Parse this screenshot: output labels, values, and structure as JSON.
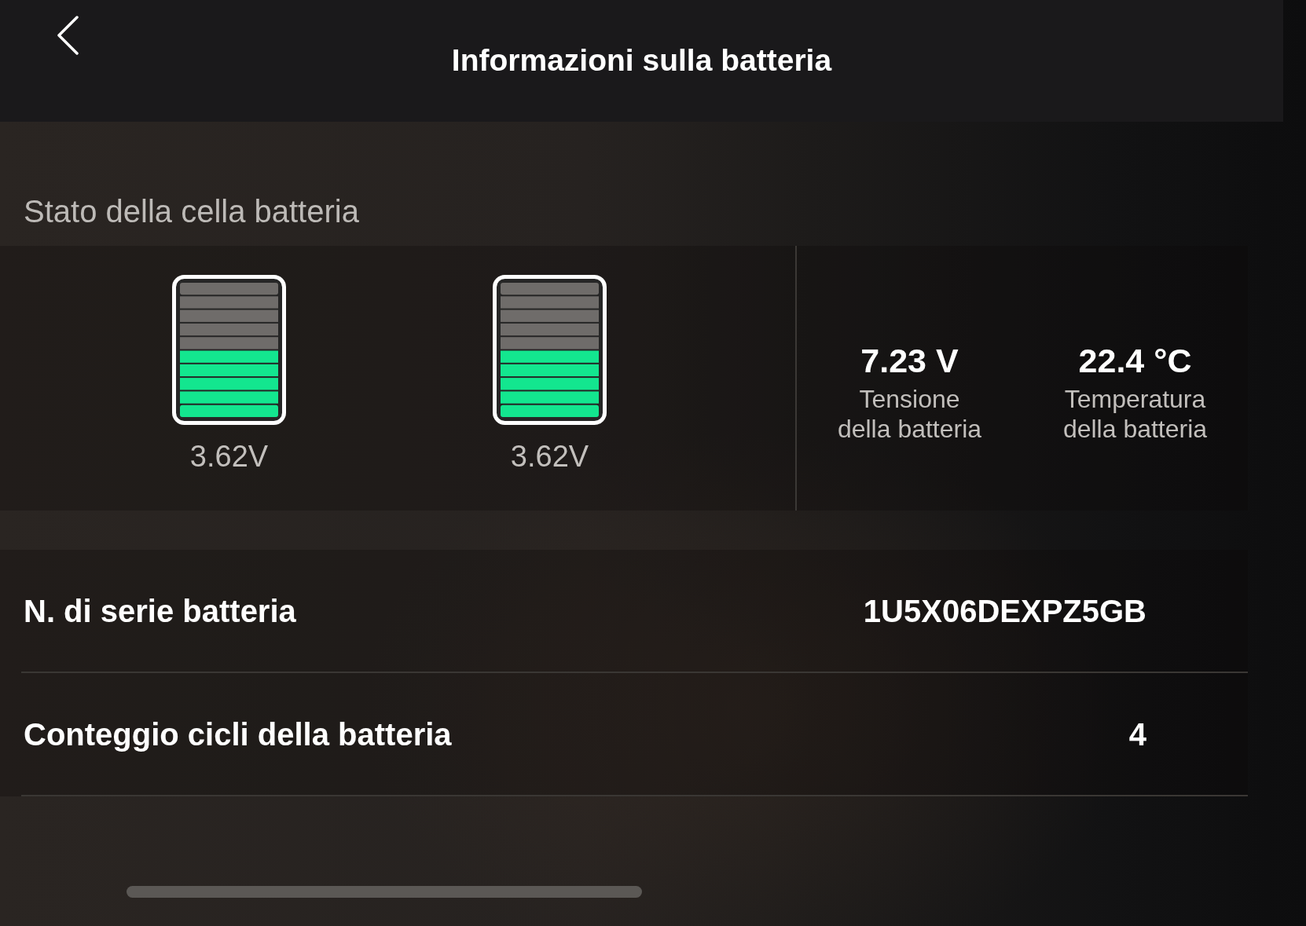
{
  "header": {
    "title": "Informazioni sulla batteria"
  },
  "cell_status": {
    "heading": "Stato della cella batteria",
    "cells": [
      {
        "level": 0.5,
        "voltage": "3.62V"
      },
      {
        "level": 0.5,
        "voltage": "3.62V"
      }
    ],
    "stats": [
      {
        "value": "7.23 V",
        "label": "Tensione\ndella batteria"
      },
      {
        "value": "22.4 °C",
        "label": "Temperatura\ndella batteria"
      }
    ]
  },
  "rows": [
    {
      "label": "N. di serie batteria",
      "value": "1U5X06DEXPZ5GB"
    },
    {
      "label": "Conteggio cicli della batteria",
      "value": "4"
    }
  ]
}
